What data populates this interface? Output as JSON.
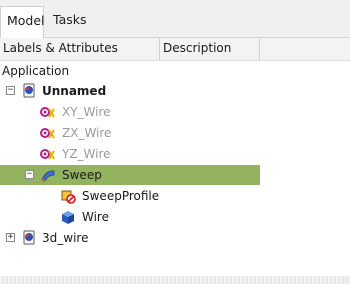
{
  "tabs": [
    {
      "label": "Model",
      "active": true
    },
    {
      "label": "Tasks",
      "active": false
    }
  ],
  "columns": {
    "labels": "Labels & Attributes",
    "description": "Description"
  },
  "tree": {
    "root": "Application",
    "unnamed": {
      "label": "Unnamed",
      "expander": "−",
      "icon": "document-icon"
    },
    "xy_wire": {
      "label": "XY_Wire",
      "icon": "wire-hidden-icon"
    },
    "zx_wire": {
      "label": "ZX_Wire",
      "icon": "wire-hidden-icon"
    },
    "yz_wire": {
      "label": "YZ_Wire",
      "icon": "wire-hidden-icon"
    },
    "sweep": {
      "label": "Sweep",
      "expander": "−",
      "icon": "sweep-icon"
    },
    "sweep_profile": {
      "label": "SweepProfile",
      "icon": "profile-error-icon"
    },
    "wire": {
      "label": "Wire",
      "icon": "solid-box-icon"
    },
    "wire3d": {
      "label": "3d_wire",
      "expander": "+",
      "icon": "document-icon"
    }
  },
  "colors": {
    "selection": "#93b35e",
    "hidden_text": "#9a9a9a"
  }
}
